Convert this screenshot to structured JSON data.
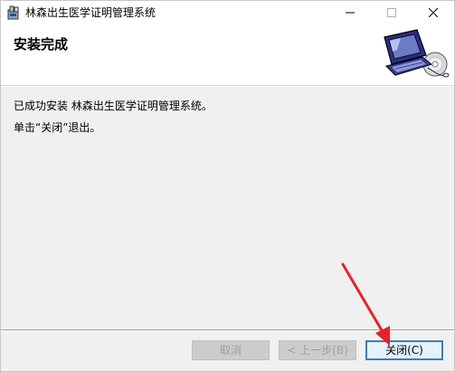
{
  "window": {
    "title": "林森出生医学证明管理系统"
  },
  "header": {
    "heading": "安装完成"
  },
  "content": {
    "line1": "已成功安装 林森出生医学证明管理系统。",
    "line2": "单击“关闭”退出。"
  },
  "footer": {
    "cancel_label": "取消",
    "back_label": "< 上一步(B)",
    "close_label": "关闭(C)"
  },
  "colors": {
    "accent": "#3c7fb1",
    "annotation_arrow": "#e8202a"
  },
  "icons": {
    "app": "installer-icon",
    "minimize": "minimize-icon",
    "maximize": "maximize-icon",
    "close": "close-icon",
    "banner": "computer-cd-icon"
  }
}
